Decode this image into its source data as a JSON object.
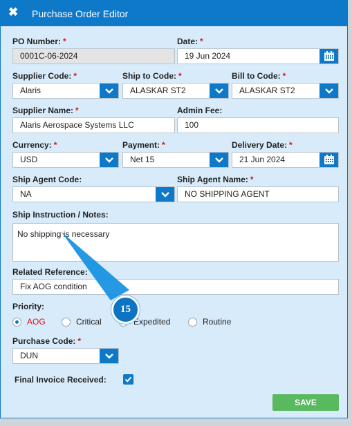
{
  "dialog": {
    "title": "Purchase Order Editor",
    "close_icon": "close-icon"
  },
  "fields": {
    "po_number": {
      "label": "PO Number:",
      "value": "0001C-06-2024"
    },
    "date": {
      "label": "Date:",
      "value": "19 Jun 2024"
    },
    "supplier_code": {
      "label": "Supplier Code:",
      "value": "Alaris"
    },
    "ship_to_code": {
      "label": "Ship to Code:",
      "value": "ALASKAR ST2"
    },
    "bill_to_code": {
      "label": "Bill to Code:",
      "value": "ALASKAR ST2"
    },
    "supplier_name": {
      "label": "Supplier Name:",
      "value": "Alaris Aerospace Systems LLC"
    },
    "admin_fee": {
      "label": "Admin Fee:",
      "value": "100"
    },
    "currency": {
      "label": "Currency:",
      "value": "USD"
    },
    "payment": {
      "label": "Payment:",
      "value": "Net 15"
    },
    "delivery_date": {
      "label": "Delivery Date:",
      "value": "21 Jun 2024"
    },
    "ship_agent_code": {
      "label": "Ship Agent Code:",
      "value": "NA"
    },
    "ship_agent_name": {
      "label": "Ship Agent Name:",
      "value": "NO SHIPPING AGENT"
    },
    "notes": {
      "label": "Ship Instruction / Notes:",
      "value": "No shipping is necessary"
    },
    "related_reference": {
      "label": "Related Reference:",
      "value": "Fix AOG condition"
    },
    "priority": {
      "label": "Priority:",
      "options": [
        "AOG",
        "Critical",
        "Expedited",
        "Routine"
      ],
      "selected": "AOG"
    },
    "purchase_code": {
      "label": "Purchase Code:",
      "value": "DUN"
    },
    "final_invoice": {
      "label": "Final Invoice Received:",
      "checked": true
    }
  },
  "required_marker": "*",
  "save_label": "SAVE",
  "callout": {
    "number": "15"
  },
  "colors": {
    "accent": "#0f79c9",
    "required": "#dd1111",
    "save": "#58b95f",
    "panel": "#d8ebfa"
  }
}
